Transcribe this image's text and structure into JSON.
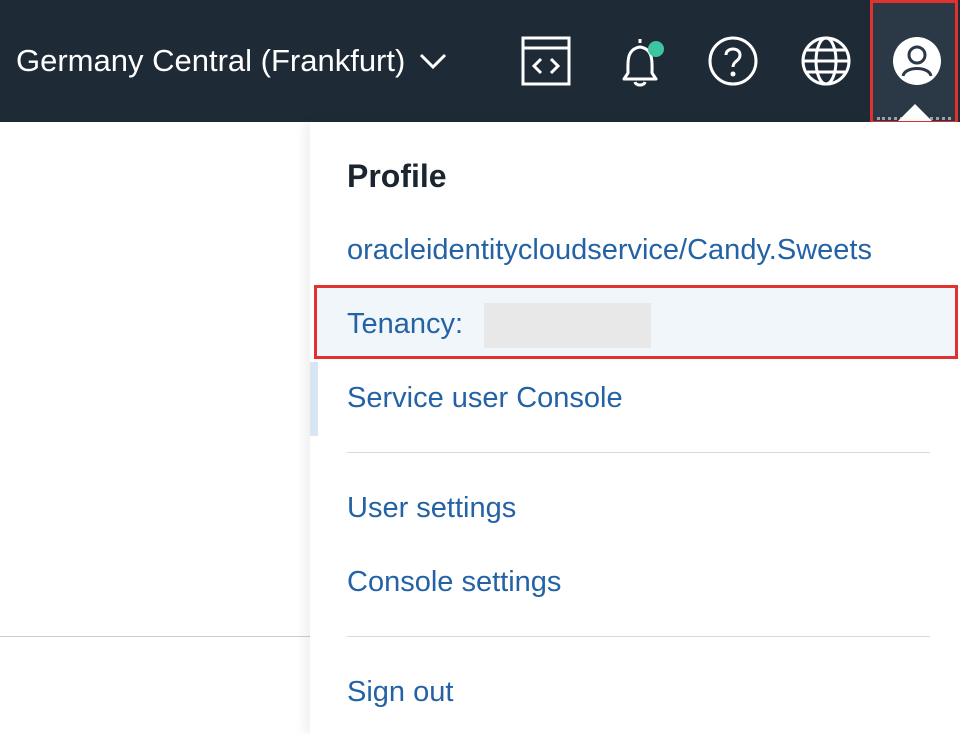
{
  "header": {
    "region_label": "Germany Central (Frankfurt)",
    "region_dropdown_icon": "chevron-down-icon",
    "icons": [
      {
        "name": "code-editor-icon"
      },
      {
        "name": "bell-icon",
        "has_notification_dot": true,
        "dot_color": "#3ec4a0"
      },
      {
        "name": "help-icon"
      },
      {
        "name": "globe-icon"
      },
      {
        "name": "user-profile-icon"
      }
    ],
    "background_color": "#1f2a37",
    "highlight_color": "#e0322f"
  },
  "profile_menu": {
    "heading": "Profile",
    "username": "oracleidentitycloudservice/Candy.Sweets",
    "tenancy_label": "Tenancy:",
    "service_console": "Service user Console",
    "user_settings": "User settings",
    "console_settings": "Console settings",
    "sign_out": "Sign out",
    "link_color": "#2462a6"
  }
}
